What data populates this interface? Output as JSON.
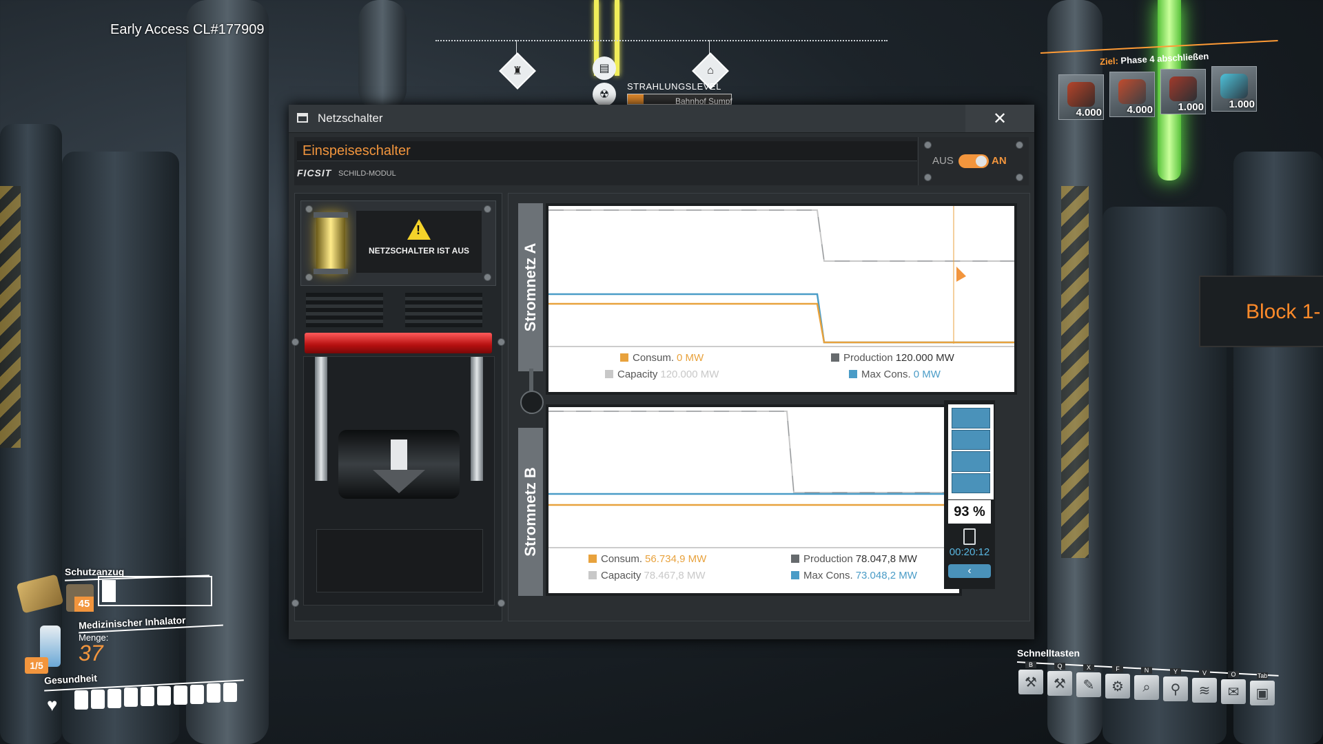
{
  "hud": {
    "build_label": "Early Access CL#177909",
    "radiation_label": "STRAHLUNGSLEVEL",
    "location_label": "Bahnhof Sumpf",
    "radiation_level": 0.15,
    "goal": {
      "prefix": "Ziel:",
      "text": "Phase 4 abschließen",
      "items": [
        {
          "qty": "4.000"
        },
        {
          "qty": "4.000"
        },
        {
          "qty": "1.000"
        },
        {
          "qty": "1.000"
        }
      ]
    },
    "block_label": "Block 1-"
  },
  "window": {
    "title": "Netzschalter",
    "close_glyph": "✕",
    "name_value": "Einspeiseschalter",
    "brand": "FICSIT",
    "module": "SCHILD-MODUL",
    "toggle": {
      "off_label": "AUS",
      "on_label": "AN",
      "state": "on"
    },
    "warning_text": "NETZSCHALTER IST AUS"
  },
  "grid_a": {
    "tab_label": "Stromnetz A",
    "legend": {
      "consum_label": "Consum.",
      "consum_value": "0 MW",
      "production_label": "Production",
      "production_value": "120.000 MW",
      "capacity_label": "Capacity",
      "capacity_value": "120.000 MW",
      "maxcons_label": "Max Cons.",
      "maxcons_value": "0 MW"
    }
  },
  "grid_b": {
    "tab_label": "Stromnetz B",
    "legend": {
      "consum_label": "Consum.",
      "consum_value": "56.734,9 MW",
      "production_label": "Production",
      "production_value": "78.047,8 MW",
      "capacity_label": "Capacity",
      "capacity_value": "78.467,8 MW",
      "maxcons_label": "Max Cons.",
      "maxcons_value": "73.048,2 MW"
    },
    "battery": {
      "percent_label": "93 %",
      "level": 0.93,
      "timer": "00:20:12",
      "collapse_glyph": "‹"
    }
  },
  "colors": {
    "accent": "#f2953d",
    "consum": "#e8a23d",
    "production": "#666a6d",
    "capacity": "#c8c8c8",
    "maxcons": "#4a9cc7"
  },
  "status": {
    "suit_label": "Schutzanzug",
    "suit_count": "45",
    "inhaler_label": "Medizinischer Inhalator",
    "amount_label": "Menge:",
    "amount_value": "37",
    "inhaler_fraction": "1/5",
    "health_label": "Gesundheit",
    "health_cells": 10
  },
  "quickkeys": {
    "title": "Schnelltasten",
    "keys": [
      "B",
      "Q",
      "X",
      "F",
      "N",
      "Y",
      "V",
      "O",
      "Tab"
    ],
    "icons": [
      "build-gun-icon",
      "hammer-icon",
      "paint-icon",
      "dismantle-icon",
      "scan-icon",
      "map-pin-icon",
      "wifi-icon",
      "envelope-icon",
      "box-icon"
    ]
  },
  "compass": {
    "markers": [
      "tower-icon",
      "train-icon",
      "radiation-icon",
      "station-icon"
    ]
  }
}
